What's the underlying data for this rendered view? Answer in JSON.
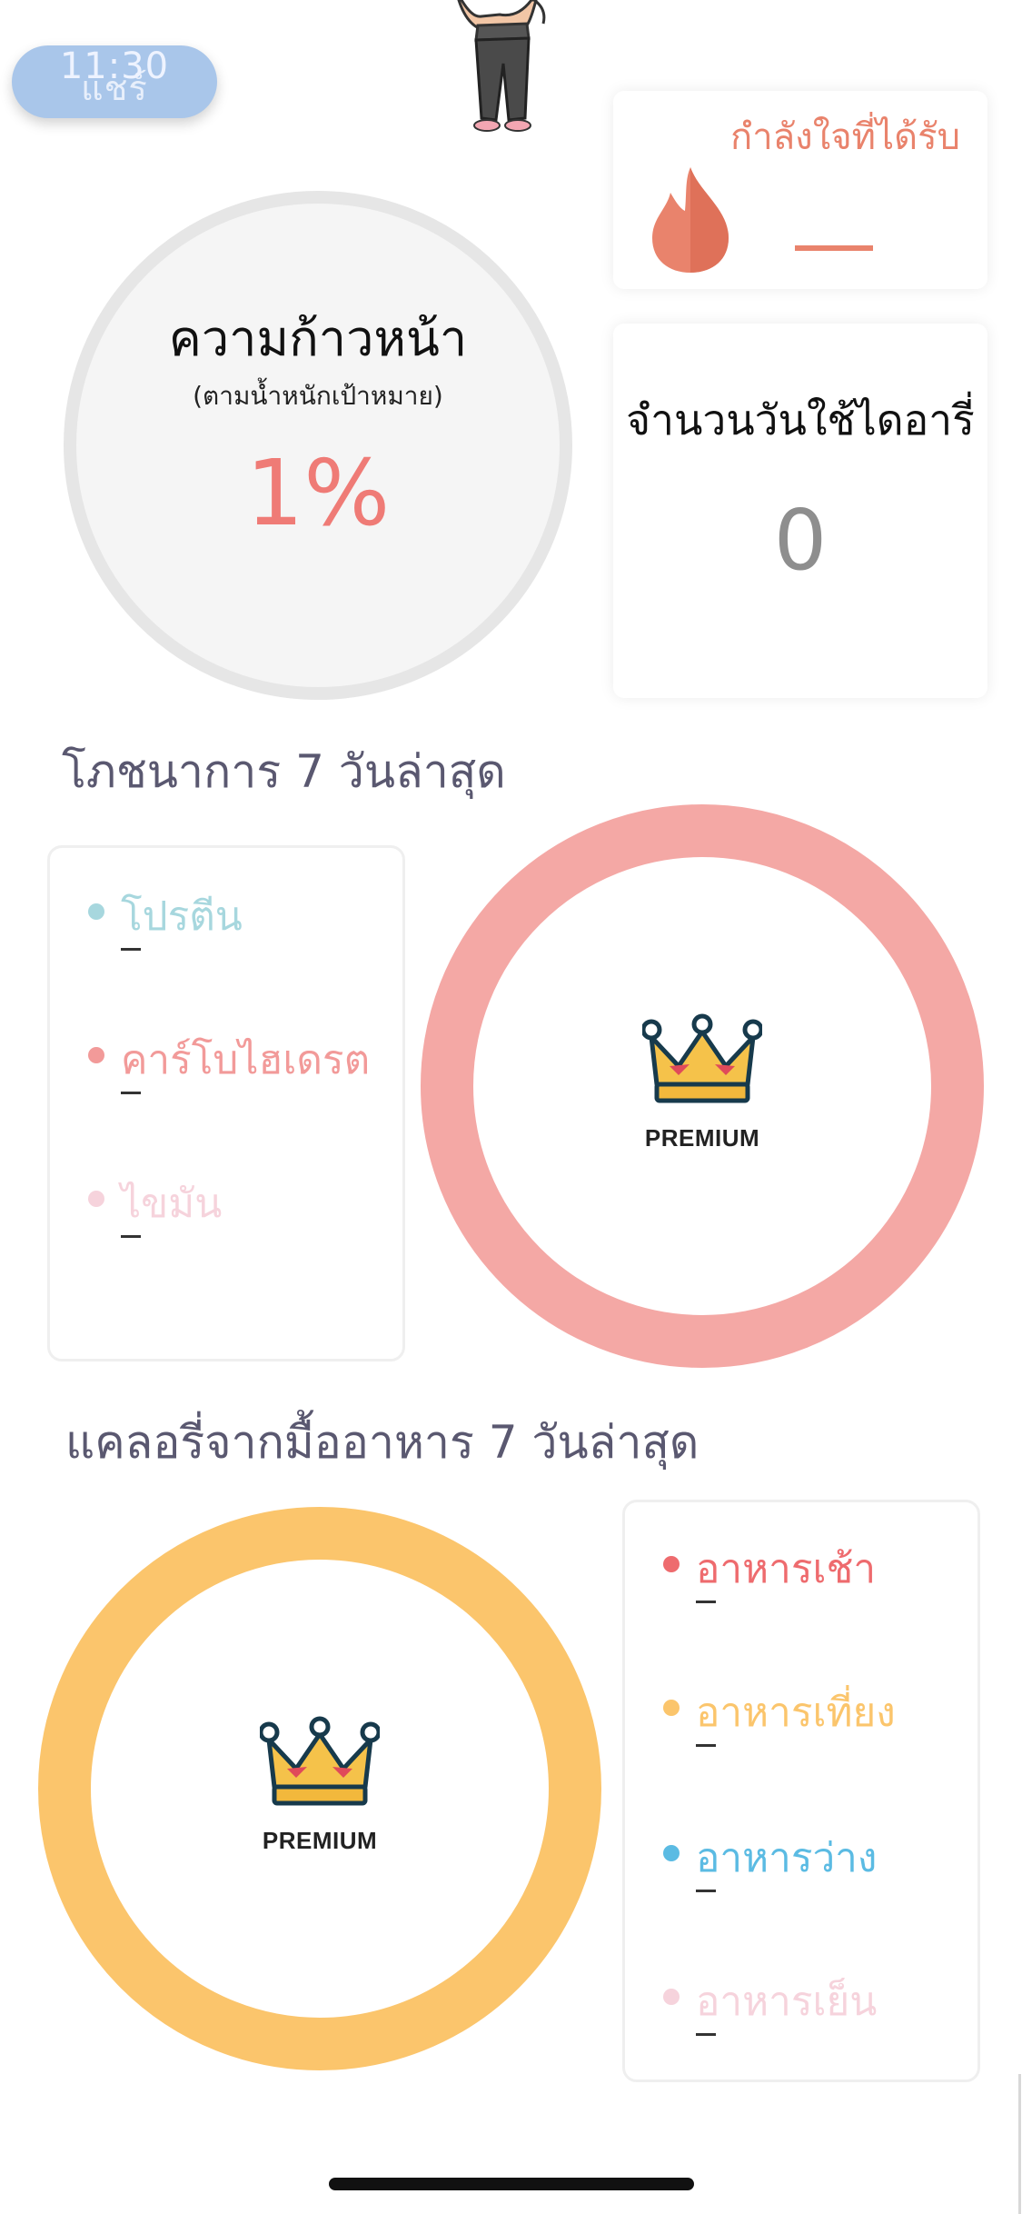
{
  "status_bar": {
    "time": "11:30"
  },
  "share_button": {
    "label": "แชร์"
  },
  "encouragement": {
    "title": "กำลังใจที่ได้รับ",
    "value": "–",
    "icon": "flame-icon",
    "color": "#e9836c"
  },
  "diary_days": {
    "title": "จำนวนวันใช้ไดอารี่",
    "value": "0"
  },
  "progress": {
    "title": "ความก้าวหน้า",
    "subtitle": "(ตามน้ำหนักเป้าหมาย)",
    "value": "1%",
    "color": "#ef7b76"
  },
  "nutrition": {
    "heading": "โภชนาการ 7 วันล่าสุด",
    "premium_label": "PREMIUM",
    "ring_color": "#f4a8a5",
    "items": [
      {
        "label": "โปรตีน",
        "value": "–",
        "color": "#a7d7de"
      },
      {
        "label": "คาร์โบไฮเดรต",
        "value": "–",
        "color": "#f29a99"
      },
      {
        "label": "ไขมัน",
        "value": "–",
        "color": "#f6d3dc"
      }
    ]
  },
  "meals": {
    "heading": "แคลอรี่จากมื้ออาหาร 7 วันล่าสุด",
    "premium_label": "PREMIUM",
    "ring_color": "#fbc56c",
    "items": [
      {
        "label": "อาหารเช้า",
        "value": "–",
        "color": "#ee6b6e"
      },
      {
        "label": "อาหารเที่ยง",
        "value": "–",
        "color": "#fbc56c"
      },
      {
        "label": "อาหารว่าง",
        "value": "–",
        "color": "#5bbbe3"
      },
      {
        "label": "อาหารเย็น",
        "value": "–",
        "color": "#f6d3dc"
      }
    ]
  }
}
